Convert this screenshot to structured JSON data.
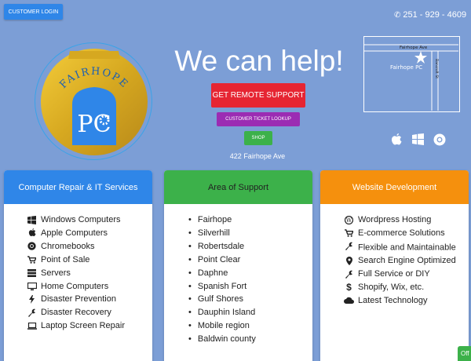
{
  "header": {
    "login_label": "CUSTOMER LOGIN",
    "phone": "251 - 929 - 4609"
  },
  "logo": {
    "text_top": "FAIRHOPE",
    "text_mark": "PC"
  },
  "hero": {
    "title": "We can help!",
    "remote_support": "GET REMOTE SUPPORT",
    "ticket_lookup": "CUSTOMER TICKET LOOKUP",
    "shop": "SHOP",
    "address": "422 Fairhope Ave"
  },
  "map": {
    "street_top": "Fairhope Ave",
    "street_side": "Bancroft St",
    "place": "Fairhope PC"
  },
  "os_icons": [
    "apple-icon",
    "windows-icon",
    "chrome-icon"
  ],
  "cards": {
    "repair": {
      "title": "Computer Repair & IT Services",
      "color": "#2f86e8",
      "items": [
        {
          "icon": "windows-icon",
          "label": "Windows Computers"
        },
        {
          "icon": "apple-icon",
          "label": "Apple Computers"
        },
        {
          "icon": "chrome-icon",
          "label": "Chromebooks"
        },
        {
          "icon": "cart-icon",
          "label": "Point of Sale"
        },
        {
          "icon": "server-icon",
          "label": "Servers"
        },
        {
          "icon": "desktop-icon",
          "label": "Home Computers"
        },
        {
          "icon": "bolt-icon",
          "label": "Disaster Prevention"
        },
        {
          "icon": "wrench-icon",
          "label": "Disaster Recovery"
        },
        {
          "icon": "laptop-icon",
          "label": "Laptop Screen Repair"
        }
      ]
    },
    "area": {
      "title": "Area of Support",
      "color": "#3cb14a",
      "items": [
        "Fairhope",
        "Silverhill",
        "Robertsdale",
        "Point Clear",
        "Daphne",
        "Spanish Fort",
        "Gulf Shores",
        "Dauphin Island",
        "Mobile region",
        "Baldwin county"
      ]
    },
    "web": {
      "title": "Website Development",
      "color": "#f5900d",
      "items": [
        {
          "icon": "wordpress-icon",
          "label": "Wordpress Hosting"
        },
        {
          "icon": "cart-icon",
          "label": "E-commerce Solutions"
        },
        {
          "icon": "wrench-icon",
          "label": "Flexible and Maintainable"
        },
        {
          "icon": "map-marker-icon",
          "label": "Search Engine Optimized"
        },
        {
          "icon": "wrench-icon",
          "label": "Full Service or DIY"
        },
        {
          "icon": "dollar-icon",
          "label": "Shopify, Wix, etc."
        },
        {
          "icon": "cloud-icon",
          "label": "Latest Technology"
        }
      ]
    }
  },
  "chat_tab": "Off"
}
